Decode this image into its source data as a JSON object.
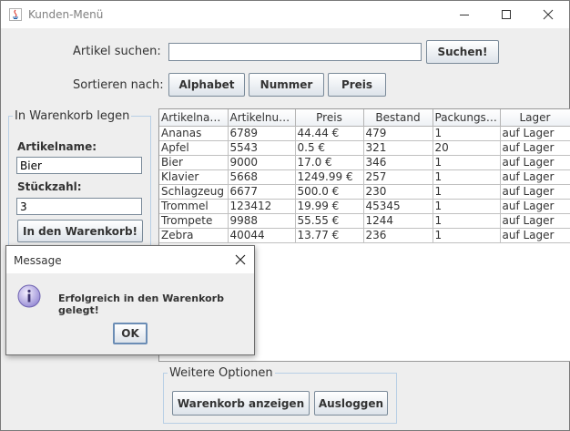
{
  "window": {
    "title": "Kunden-Menü",
    "controls": [
      "minimize",
      "maximize",
      "close"
    ]
  },
  "search": {
    "label": "Artikel suchen:",
    "value": "",
    "button_label": "Suchen!"
  },
  "sort": {
    "label": "Sortieren nach:",
    "buttons": [
      "Alphabet",
      "Nummer",
      "Preis"
    ]
  },
  "cart_panel": {
    "legend": "In Warenkorb legen",
    "name_label": "Artikelname:",
    "name_value": "Bier",
    "qty_label": "Stückzahl:",
    "qty_value": "3",
    "add_button": "In den Warenkorb!"
  },
  "table": {
    "headers": [
      "Artikelname",
      "Artikelnum...",
      "Preis",
      "Bestand",
      "Packungsg...",
      "Lager"
    ],
    "rows": [
      [
        "Ananas",
        "6789",
        "44.44 €",
        "479",
        "1",
        "auf Lager"
      ],
      [
        "Apfel",
        "5543",
        "0.5 €",
        "321",
        "20",
        "auf Lager"
      ],
      [
        "Bier",
        "9000",
        "17.0 €",
        "346",
        "1",
        "auf Lager"
      ],
      [
        "Klavier",
        "5668",
        "1249.99 €",
        "257",
        "1",
        "auf Lager"
      ],
      [
        "Schlagzeug",
        "6677",
        "500.0 €",
        "230",
        "1",
        "auf Lager"
      ],
      [
        "Trommel",
        "123412",
        "19.99 €",
        "45345",
        "1",
        "auf Lager"
      ],
      [
        "Trompete",
        "9988",
        "55.55 €",
        "1244",
        "1",
        "auf Lager"
      ],
      [
        "Zebra",
        "40044",
        "13.77 €",
        "236",
        "1",
        "auf Lager"
      ]
    ]
  },
  "options": {
    "legend": "Weitere Optionen",
    "show_cart_button": "Warenkorb anzeigen",
    "logout_button": "Ausloggen"
  },
  "dialog": {
    "title": "Message",
    "message": "Erfolgreich in den Warenkorb gelegt!",
    "ok_label": "OK",
    "icon": "info-icon"
  }
}
